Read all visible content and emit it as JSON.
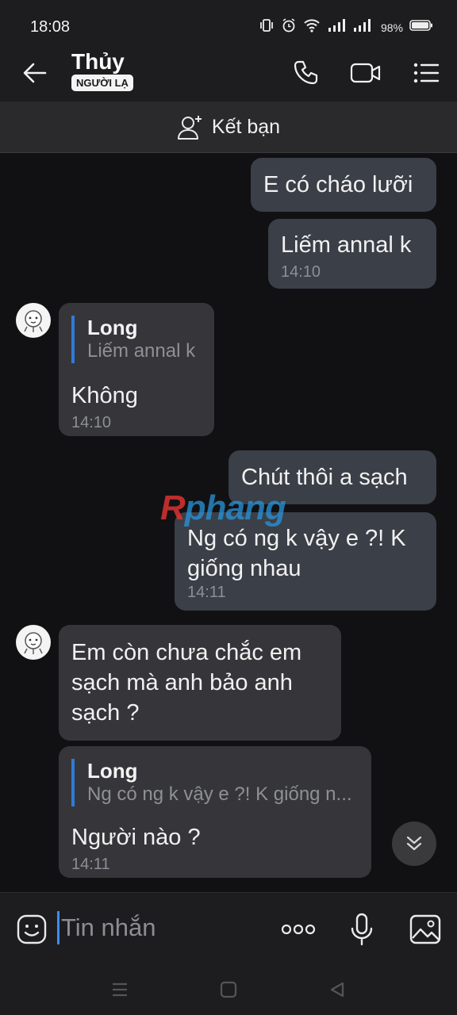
{
  "status_bar": {
    "time": "18:08",
    "battery": "98%"
  },
  "header": {
    "title": "Thủy",
    "badge": "NGƯỜI LẠ"
  },
  "friend_bar": {
    "label": "Kết bạn"
  },
  "messages": [
    {
      "direction": "out",
      "text": "E có cháo lưỡi"
    },
    {
      "direction": "out",
      "text": "Liếm annal k",
      "time": "14:10"
    },
    {
      "direction": "in",
      "quote": {
        "name": "Long",
        "text": "Liếm annal k"
      },
      "text": "Không",
      "time": "14:10"
    },
    {
      "direction": "out",
      "text": "Chút thôi a sạch"
    },
    {
      "direction": "out",
      "text": "Ng có ng k vậy e ?! K giống nhau",
      "time": "14:11"
    },
    {
      "direction": "in",
      "text": "Em còn chưa chắc em sạch mà anh bảo anh sạch ?"
    },
    {
      "direction": "in",
      "quote": {
        "name": "Long",
        "text": "Ng có ng k vậy e ?! K giống n..."
      },
      "text": "Người nào ?",
      "time": "14:11"
    }
  ],
  "watermark": {
    "first": "R",
    "rest": "phang"
  },
  "input": {
    "placeholder": "Tin nhắn"
  },
  "colors": {
    "accent": "#2f7bd8",
    "bubble_in": "#36363a",
    "bubble_out": "#3b3f47",
    "background": "#111113"
  }
}
